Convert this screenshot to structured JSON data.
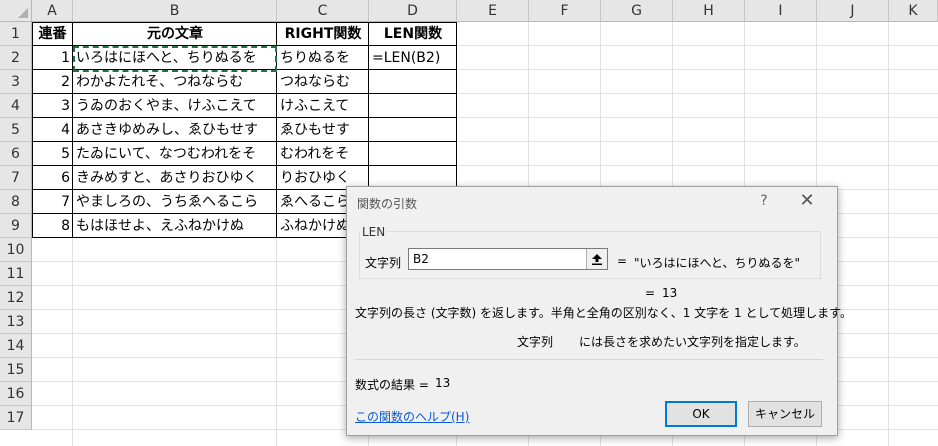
{
  "columns": [
    "A",
    "B",
    "C",
    "D",
    "E",
    "F",
    "G",
    "H",
    "I",
    "J",
    "K"
  ],
  "rows": [
    "1",
    "2",
    "3",
    "4",
    "5",
    "6",
    "7",
    "8",
    "9",
    "10",
    "11",
    "12",
    "13",
    "14",
    "15",
    "16",
    "17"
  ],
  "table": {
    "headers": [
      "連番",
      "元の文章",
      "RIGHT関数",
      "LEN関数"
    ],
    "data": [
      {
        "no": "1",
        "text": "いろはにほへと、ちりぬるを",
        "right": "ちりぬるを",
        "len": "=LEN(B2)"
      },
      {
        "no": "2",
        "text": "わかよたれそ、つねならむ",
        "right": "つねならむ",
        "len": ""
      },
      {
        "no": "3",
        "text": "うゐのおくやま、けふこえて",
        "right": "けふこえて",
        "len": ""
      },
      {
        "no": "4",
        "text": "あさきゆめみし、ゑひもせす",
        "right": "ゑひもせす",
        "len": ""
      },
      {
        "no": "5",
        "text": "たゐにいて、なつむわれをそ",
        "right": "むわれをそ",
        "len": ""
      },
      {
        "no": "6",
        "text": "きみめすと、あさりおひゆく",
        "right": "りおひゆく",
        "len": ""
      },
      {
        "no": "7",
        "text": "やましろの、うちゑへるこら",
        "right": "ゑへるこら",
        "len": ""
      },
      {
        "no": "8",
        "text": "もはほせよ、えふねかけぬ",
        "right": "ふねかけぬ",
        "len": ""
      }
    ]
  },
  "dialog": {
    "title": "関数の引数",
    "help_glyph": "?",
    "close_glyph": "✕",
    "function_name": "LEN",
    "arg_label": "文字列",
    "arg_value": "B2",
    "arg_eq": "=",
    "arg_result": "\"いろはにほへと、ちりぬるを\"",
    "result_eq": "=",
    "result_value": "13",
    "description": "文字列の長さ (文字数) を返します。半角と全角の区別なく、1 文字を 1 として処理します。",
    "arg_help_name": "文字列",
    "arg_help_text": "には長さを求めたい文字列を指定します。",
    "formula_result_label": "数式の結果 =",
    "formula_result_value": "13",
    "help_link": "この関数のヘルプ(H)",
    "ok": "OK",
    "cancel": "キャンセル"
  },
  "colors": {
    "copy_border": "#217346",
    "header_bg": "#e6e6e6",
    "ok_focus": "#0078d7",
    "link": "#0b5ad8"
  }
}
